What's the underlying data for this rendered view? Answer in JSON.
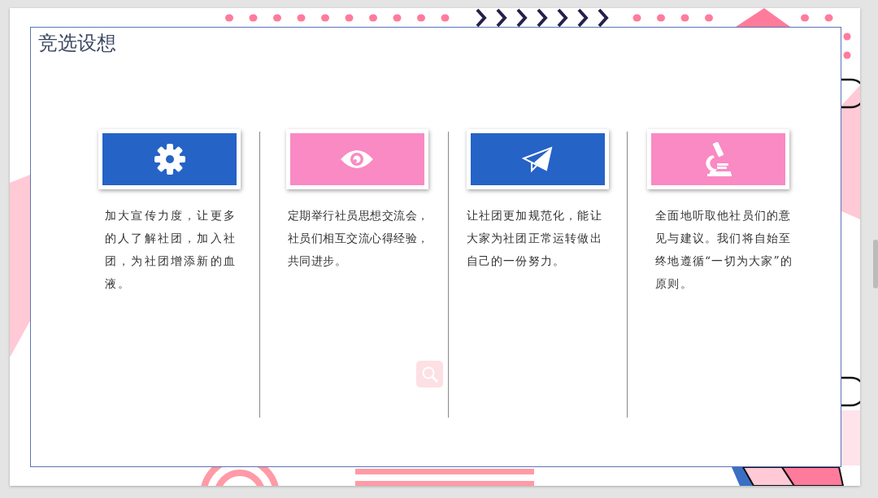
{
  "slide": {
    "title": "竞选设想",
    "features": [
      {
        "kind": "gear",
        "color": "#2563c7",
        "text": "加大宣传力度，让更多的人了解社团，加入社团，为社团增添新的血液。"
      },
      {
        "kind": "eye",
        "color": "#f98ac3",
        "text": "定期举行社员思想交流会，社员们相互交流心得经验，共同进步。"
      },
      {
        "kind": "plane",
        "color": "#2563c7",
        "text": "让社团更加规范化，能让大家为社团正常运转做出自己的一份努力。"
      },
      {
        "kind": "microscope",
        "color": "#f98ac3",
        "text": "全面地听取他社员们的意见与建议。我们将自始至终地遵循“一切为大家”的原则。"
      }
    ]
  }
}
